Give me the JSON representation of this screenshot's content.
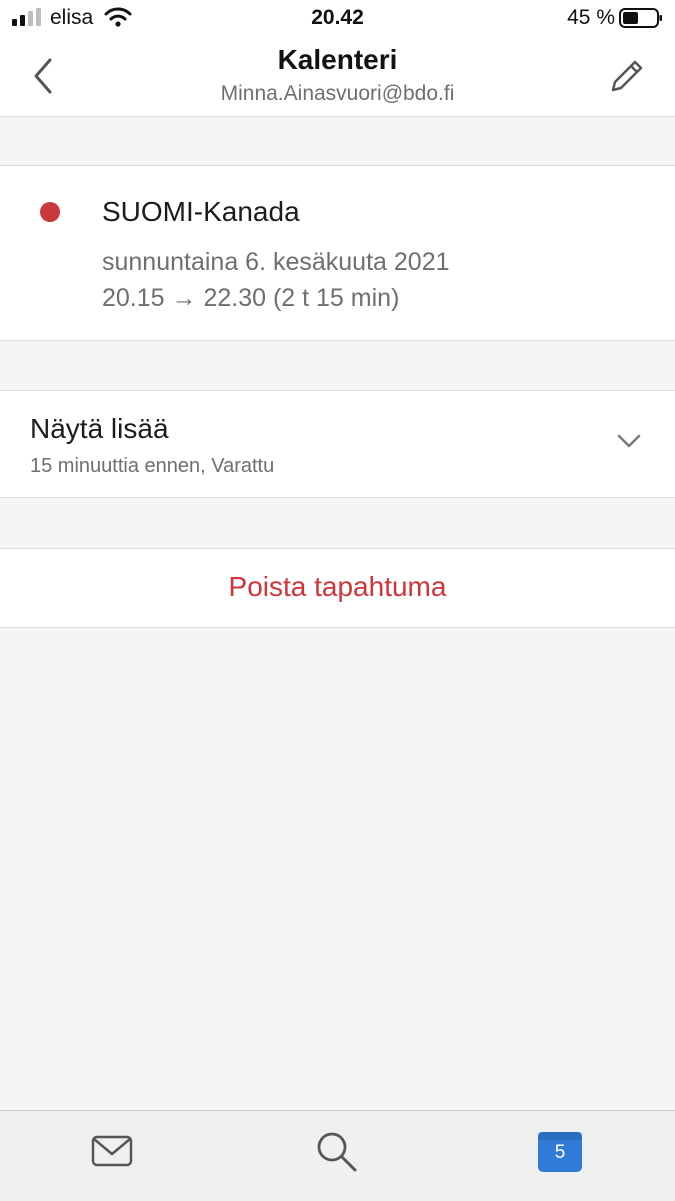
{
  "status": {
    "carrier": "elisa",
    "time": "20.42",
    "battery": "45 %"
  },
  "nav": {
    "title": "Kalenteri",
    "subtitle": "Minna.Ainasvuori@bdo.fi",
    "back_icon": "chevron-left-icon",
    "edit_icon": "pencil-icon"
  },
  "event": {
    "title": "SUOMI-Kanada",
    "date": "sunnuntaina 6. kesäkuuta 2021",
    "time": "20.15 → 22.30 (2 t 15 min)",
    "color": "#c8383c"
  },
  "more": {
    "title": "Näytä lisää",
    "subtitle": "15 minuuttia ennen, Varattu",
    "icon": "chevron-down-icon"
  },
  "delete": {
    "label": "Poista tapahtuma",
    "color": "#d13438"
  },
  "tabs": {
    "mail_icon": "mail-icon",
    "search_icon": "search-icon",
    "calendar_icon": "calendar-icon",
    "calendar_day": "5",
    "accent": "#2f7bd5"
  }
}
